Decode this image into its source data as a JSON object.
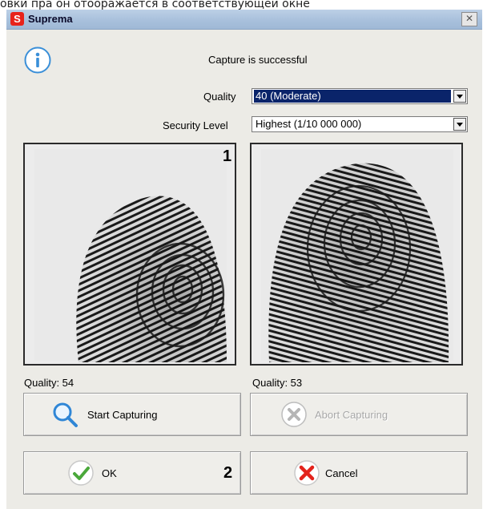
{
  "background_text": "овки пра он отооражается в соответствующей окне",
  "window": {
    "title": "Suprema",
    "close_glyph": "✕",
    "logo_letter": "S"
  },
  "message": "Capture is successful",
  "quality_field": {
    "label": "Quality",
    "value": "40 (Moderate)"
  },
  "security_field": {
    "label": "Security Level",
    "value": "Highest (1/10 000 000)"
  },
  "fingerprints": [
    {
      "marker": "1",
      "quality_text": "Quality: 54"
    },
    {
      "marker": "",
      "quality_text": "Quality: 53"
    }
  ],
  "buttons": {
    "start": "Start Capturing",
    "abort": "Abort Capturing",
    "ok": "OK",
    "cancel": "Cancel"
  },
  "button_marker": "2",
  "colors": {
    "titlebar": "#a7bfdb",
    "selection": "#0a246a",
    "info": "#3a8fd8",
    "check": "#4aa83a",
    "cancel": "#e3231b"
  }
}
